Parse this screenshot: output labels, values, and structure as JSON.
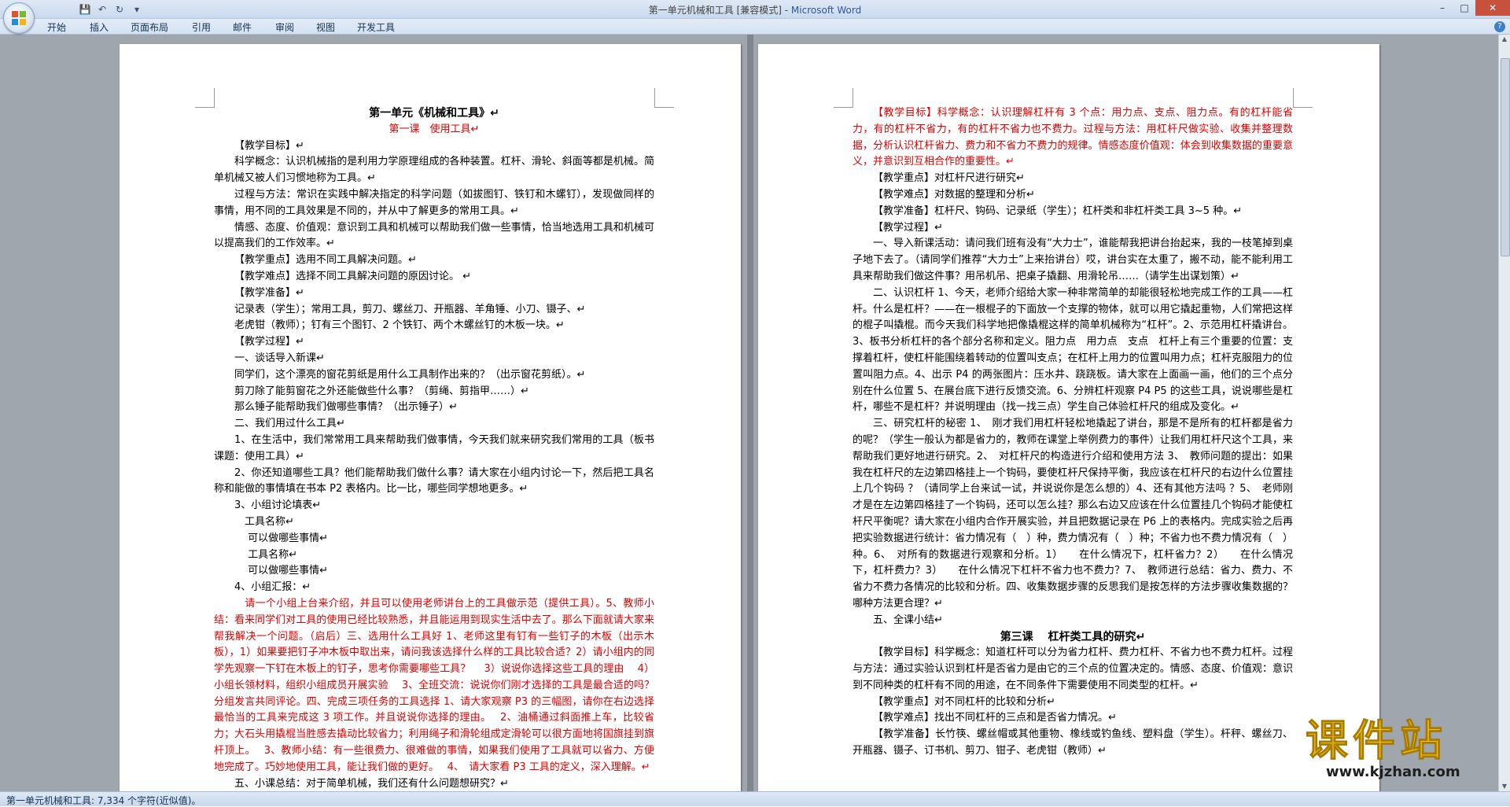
{
  "window": {
    "title": "第一单元机械和工具 [兼容模式] - ",
    "app_name": "Microsoft Word"
  },
  "quick_access": {
    "save_icon": "save-icon",
    "undo_icon": "undo-icon",
    "redo_icon": "redo-icon",
    "customize_icon": "customize-qat-icon"
  },
  "ribbon_tabs": [
    "开始",
    "插入",
    "页面布局",
    "引用",
    "邮件",
    "审阅",
    "视图",
    "开发工具"
  ],
  "status": {
    "word_count": "第一单元机械和工具: 7,334 个字符(近似值)。"
  },
  "watermark": {
    "cn": "课件站",
    "url": "www.kjzhan.com"
  },
  "page_left": [
    {
      "s": "t",
      "text": "第一单元《机械和工具》↵"
    },
    {
      "s": "sub",
      "text": "第一课　使用工具↵"
    },
    {
      "s": "ind",
      "text": "【教学目标】↵"
    },
    {
      "s": "ind",
      "text": "科学概念：认识机械指的是利用力学原理组成的各种装置。杠杆、滑轮、斜面等都是机械。简单机械又被人们习惯地称为工具。↵"
    },
    {
      "s": "ind",
      "text": "过程与方法：常识在实践中解决指定的科学问题（如拔图钉、铁钉和木螺钉），发现做同样的事情，用不同的工具效果是不同的，并从中了解更多的常用工具。↵"
    },
    {
      "s": "ind",
      "text": "情感、态度、价值观：意识到工具和机械可以帮助我们做一些事情，恰当地选用工具和机械可以提高我们的工作效率。↵"
    },
    {
      "s": "ind",
      "text": "【教学重点】选用不同工具解决问题。↵"
    },
    {
      "s": "ind",
      "text": "【教学难点】选择不同工具解决问题的原因讨论。 ↵"
    },
    {
      "s": "ind",
      "text": "【教学准备】↵"
    },
    {
      "s": "ind",
      "text": "记录表（学生）；常用工具，剪刀、螺丝刀、开瓶器、羊角锤、小刀、镊子、↵"
    },
    {
      "s": "ind",
      "text": "老虎钳（教师）；钉有三个图钉、2 个铁钉、两个木螺丝钉的木板一块。↵"
    },
    {
      "s": "ind",
      "text": "【教学过程】↵"
    },
    {
      "s": "ind",
      "text": "一、谈话导入新课↵"
    },
    {
      "s": "ind",
      "text": "同学们，这个漂亮的窗花剪纸是用什么工具制作出来的？（出示窗花剪纸）。↵"
    },
    {
      "s": "ind",
      "text": "剪刀除了能剪窗花之外还能做些什么事？（剪绳、剪指甲……）↵"
    },
    {
      "s": "ind",
      "text": "那么锤子能帮助我们做哪些事情？（出示锤子）↵"
    },
    {
      "s": "ind",
      "text": "二、我们用过什么工具↵"
    },
    {
      "s": "ind",
      "text": "1、在生活中，我们常常用工具来帮助我们做事情，今天我们就来研究我们常用的工具（板书课题：使用工具）↵"
    },
    {
      "s": "ind",
      "text": "2、你还知道哪些工具？他们能帮助我们做什么事？请大家在小组内讨论一下，然后把工具名称和能做的事情填在书本 P2 表格内。比一比，哪些同学想地更多。↵"
    },
    {
      "s": "ind",
      "text": "3、小组讨论填表↵"
    },
    {
      "s": "ind1",
      "text": "　工具名称↵"
    },
    {
      "s": "ind1",
      "text": "　 可以做哪些事情↵"
    },
    {
      "s": "ind1",
      "text": "　 工具名称↵"
    },
    {
      "s": "ind1",
      "text": "　 可以做哪些事情↵"
    },
    {
      "s": "ind",
      "text": "4、小组汇报：↵"
    },
    {
      "s": "red ind",
      "text": "　请一个小组上台来介绍，并且可以使用老师讲台上的工具做示范（提供工具）。5、教师小结：看来同学们对工具的使用已经比较熟悉，并且能运用到现实生活中去了。那么下面就请大家来帮我解决一个问题。（启后）三、选用什么工具好 1、老师这里有钉有一些钉子的木板（出示木板），1）如果要把钉子冲木板中取出来，请问我该选择什么样的工具比较合适？2）请小组内的同学先观察一下钉在木板上的钉子，思考你需要哪些工具？　 3）说说你选择这些工具的理由　 4）小组长领材料，组织小组成员开展实验　 3、全班交流：说说你们刚才选择的工具是最合适的吗？分组发言共同评论。四、完成三项任务的工具选择 1、请大家观察 P3 的三幅图，请你在右边选择最恰当的工具来完成这 3 项工作。并且说说你选择的理由。　 2、油桶通过斜面推上车，比较省力；大石头用撬棍当胜感去撬动比较省力；利用绳子和滑轮组成定滑轮可以很方面地将国旗挂到旗杆顶上。　 3、教师小结：有一些很费力、很难做的事情，如果我们使用了工具就可以省力、方便地完成了。巧妙地使用工具，能让我们做的更好。　 4、　请大家看 P3 工具的定义，深入理解。↵"
    },
    {
      "s": "ind",
      "text": "五、小课总结：对于简单机械，我们还有什么问题想研究？↵"
    }
  ],
  "page_right": [
    {
      "s": "red ind",
      "text": "【教学目标】科学概念：认识理解杠杆有 3 个点：用力点、支点、阻力点。有的杠杆能省力，有的杠杆不省力，有的杠杆不省力也不费力。过程与方法：用杠杆尺做实验、收集并整理数据，分析认识杠杆省力、费力和不省力不费力的规律。情感态度价值观：体会到收集数据的重要意义，并意识到互相合作的重要性。↵"
    },
    {
      "s": "ind",
      "text": "【教学重点】对杠杆尺进行研究↵"
    },
    {
      "s": "ind",
      "text": "【教学难点】对数据的整理和分析↵"
    },
    {
      "s": "ind",
      "text": "【教学准备】杠杆尺、钩码、记录纸（学生）；杠杆类和非杠杆类工具 3~5 种。↵"
    },
    {
      "s": "ind",
      "text": "【教学过程】↵"
    },
    {
      "s": "ind",
      "text": "一、导入新课活动：请问我们班有没有“大力士”，谁能帮我把讲台抬起来，我的一枝笔掉到桌子地下去了。（请同学们推荐“大力士”上来抬讲台）哎，讲台实在太重了，搬不动，能不能利用工具来帮助我们做这件事？用吊机吊、把桌子撬翻、用滑轮吊……（请学生出谋划策）↵"
    },
    {
      "s": "ind",
      "text": "二、认识杠杆 1、今天，老师介绍给大家一种非常简单的却能很轻松地完成工作的工具——杠杆。什么是杠杆？——在一根棍子的下面放一个支撑的物体，就可以用它撬起重物，人们常把这样的棍子叫撬棍。而今天我们科学地把像撬棍这样的简单机械称为“杠杆”。2、示范用杠杆撬讲台。3、板书分析杠杆的各个部分名称和定义。阻力点　用力点　支点　杠杆上有三个重要的位置：支撑着杠杆，使杠杆能围绕着转动的位置叫支点；在杠杆上用力的位置叫用力点；杠杆克服阻力的位置叫阻力点。4、出示 P4 的两张图片：压水井、跷跷板。请大家在上面画一画，他们的三个点分别在什么位置 5、在展台底下进行反馈交流。6、分辨杠杆观察 P4 P5 的这些工具，说说哪些是杠杆，哪些不是杠杆？并说明理由（找一找三点）学生自己体验杠杆尺的组成及变化。↵"
    },
    {
      "s": "ind",
      "text": "三、研究杠杆的秘密 1、　刚才我们用杠杆轻松地撬起了讲台，那是不是所有的杠杆都是省力的呢？（学生一般认为都是省力的，教师在课堂上举例费力的事件）让我们用杠杆尺这个工具，来帮助我们更好地进行研究。2、　对杠杆尺的构造进行介绍和使用方法 3、　教师问题的提出：如果我在杠杆尺的左边第四格挂上一个钩码，要使杠杆尺保持平衡，我应该在杠杆尺的右边什么位置挂上几个钩码 ？（请同学上台来试一试，并说说你是怎么想的）4、还有其他方法吗 ？5、　老师刚才是在左边第四格挂了一个钩码，还可以怎么挂？那么右边又应该在什么位置挂几个钩码才能使杠杆尺平衡呢？请大家在小组内合作开展实验，并且把数据记录在 P6 上的表格内。完成实验之后再把实验数据进行统计：省力情况有（　）种，费力情况有（　）种；不省力也不费力情况有（　）种。6、　对所有的数据进行观察和分析。1）　　在什么情况下，杠杆省力？2）　　在什么情况下，杠杆费力？3）　　在什么情况下杠杆不省力也不费力？7、　教师进行总结：省力、费力、不省力不费力各情况的比较和分析。四、收集数据步骤的反思我们是按怎样的方法步骤收集数据的？哪种方法更合理？↵"
    },
    {
      "s": "ind",
      "text": "五、全课小结↵"
    },
    {
      "s": "t",
      "text": "第三课　 杠杆类工具的研究↵"
    },
    {
      "s": "ind",
      "text": "【教学目标】科学概念：知道杠杆可以分为省力杠杆、费力杠杆、不省力也不费力杠杆。过程与方法：通过实验认识到杠杆是否省力是由它的三个点的位置决定的。情感、态度、价值观：意识到不同种类的杠杆有不同的用途，在不同条件下需要使用不同类型的杠杆。↵"
    },
    {
      "s": "ind",
      "text": "【教学重点】对不同杠杆的比较和分析↵"
    },
    {
      "s": "ind",
      "text": "【教学难点】找出不同杠杆的三点和是否省力情况。↵"
    },
    {
      "s": "ind",
      "text": "【教学准备】长竹筷、螺丝帽或其他重物、橡线或钓鱼线、塑料盘（学生）。杆秤、螺丝刀、开瓶器、镊子、订书机、剪刀、钳子、老虎钳（教师）↵"
    }
  ]
}
